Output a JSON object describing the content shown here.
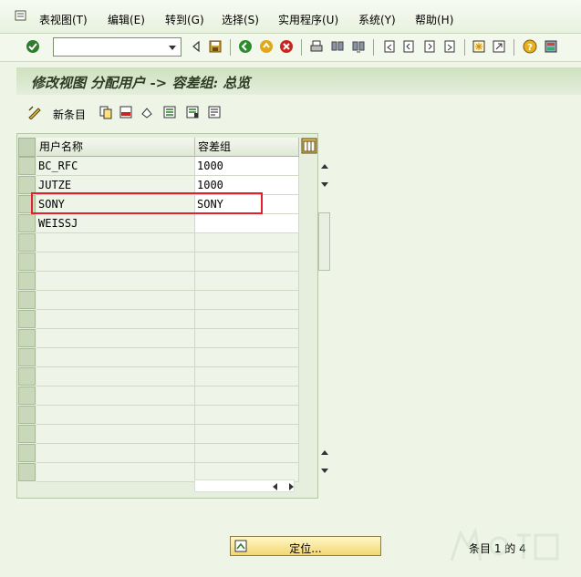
{
  "menu": {
    "items": [
      {
        "label": "表视图(T)"
      },
      {
        "label": "编辑(E)"
      },
      {
        "label": "转到(G)"
      },
      {
        "label": "选择(S)"
      },
      {
        "label": "实用程序(U)"
      },
      {
        "label": "系统(Y)"
      },
      {
        "label": "帮助(H)"
      }
    ]
  },
  "toolbar": {
    "command_field_value": "",
    "icons": [
      "enter-check-icon",
      "back-icon",
      "save-icon",
      "green-back-icon",
      "exit-icon",
      "cancel-icon",
      "print-icon",
      "find-icon",
      "find-next-icon",
      "first-page-icon",
      "prev-page-icon",
      "next-page-icon",
      "last-page-icon",
      "new-session-icon",
      "shortcut-icon",
      "help-icon",
      "customize-layout-icon"
    ]
  },
  "title": "修改视图 分配用户 -> 容差组: 总览",
  "app_toolbar": {
    "new_entries_label": "新条目",
    "icons": [
      "toggle-change-icon",
      "copy-icon",
      "delete-icon",
      "undo-icon",
      "select-all-icon",
      "select-block-icon",
      "deselect-all-icon"
    ]
  },
  "table": {
    "columns": [
      "用户名称",
      "容差组"
    ],
    "rows": [
      {
        "user": "BC_RFC",
        "group": "1000"
      },
      {
        "user": "JUTZE",
        "group": "1000"
      },
      {
        "user": "SONY",
        "group": "SONY"
      },
      {
        "user": "WEISSJ",
        "group": ""
      }
    ],
    "visible_row_slots": 17
  },
  "footer": {
    "position_button_label": "定位...",
    "entry_info": "条目 1 的 4"
  },
  "colors": {
    "background": "#eef5e7",
    "highlight_box": "#e5202c",
    "position_button": "#f3d773"
  }
}
